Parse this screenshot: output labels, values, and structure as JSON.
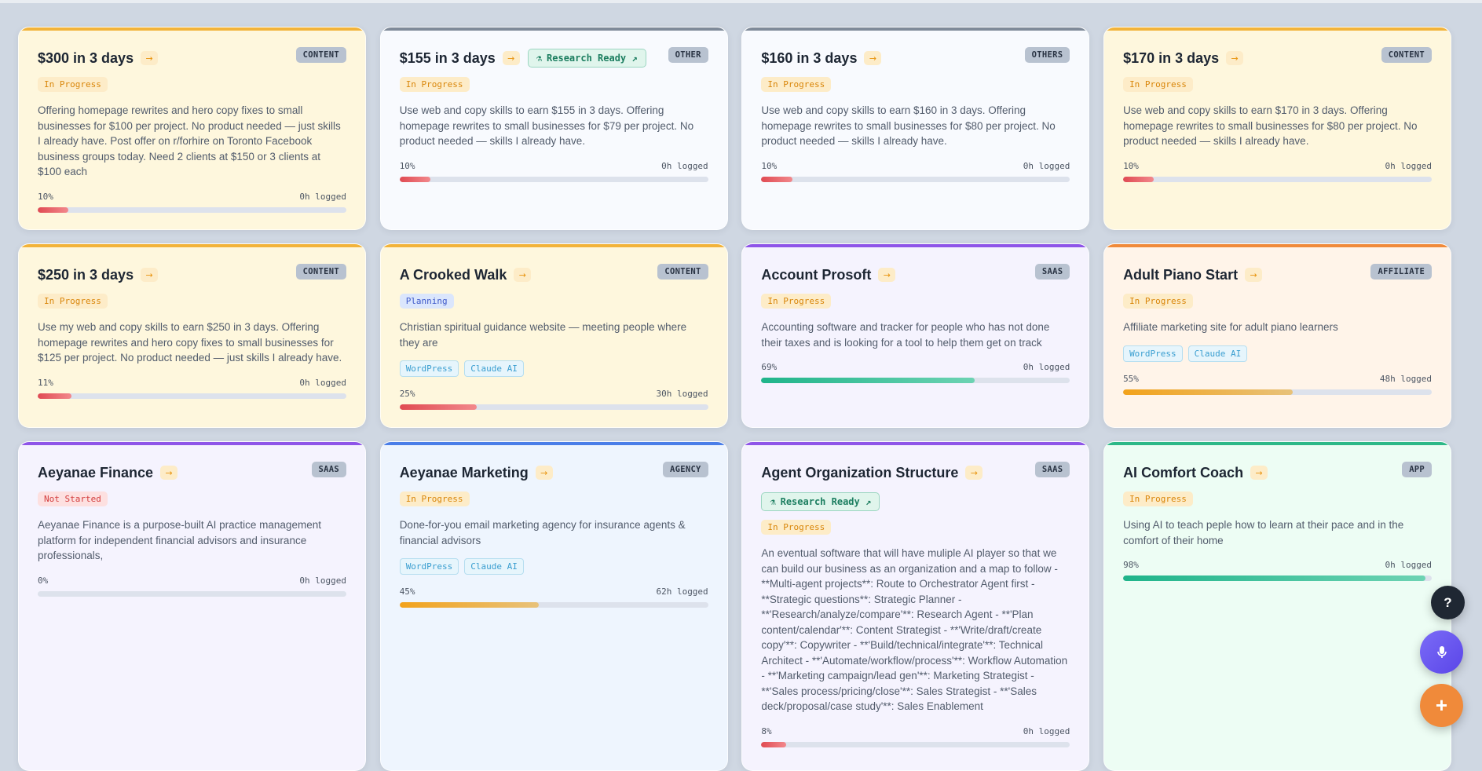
{
  "accents": {
    "yellow": "#f2b33a",
    "slate": "#7f8a99",
    "purple": "#8e55e8",
    "orange": "#f08a3a",
    "blue": "#4a7ee8",
    "green": "#2db888"
  },
  "cards": [
    {
      "title": "$300 in 3 days",
      "arrow": "→",
      "type": "CONTENT",
      "status": "In Progress",
      "research": "",
      "desc": "Offering homepage rewrites and hero copy fixes to small businesses for $100 per project. No product needed — just skills I already have. Post offer on r/forhire on Toronto Facebook business groups today. Need 2 clients at $150 or 3 clients at $100 each",
      "tags": [],
      "percent_label": "10%",
      "progress": 10,
      "logged": "0h logged"
    },
    {
      "title": "$155 in 3 days",
      "arrow": "→",
      "type": "OTHER",
      "status": "In Progress",
      "research": "Research Ready ↗",
      "desc": "Use web and copy skills to earn $155 in 3 days. Offering homepage rewrites to small businesses for $79 per project. No product needed — skills I already have.",
      "tags": [],
      "percent_label": "10%",
      "progress": 10,
      "logged": "0h logged"
    },
    {
      "title": "$160 in 3 days",
      "arrow": "→",
      "type": "OTHERS",
      "status": "In Progress",
      "research": "",
      "desc": "Use web and copy skills to earn $160 in 3 days. Offering homepage rewrites to small businesses for $80 per project. No product needed — skills I already have.",
      "tags": [],
      "percent_label": "10%",
      "progress": 10,
      "logged": "0h logged"
    },
    {
      "title": "$170 in 3 days",
      "arrow": "→",
      "type": "CONTENT",
      "status": "In Progress",
      "research": "",
      "desc": "Use web and copy skills to earn $170 in 3 days. Offering homepage rewrites to small businesses for $80 per project. No product needed — skills I already have.",
      "tags": [],
      "percent_label": "10%",
      "progress": 10,
      "logged": "0h logged"
    },
    {
      "title": "$250 in 3 days",
      "arrow": "→",
      "type": "CONTENT",
      "status": "In Progress",
      "research": "",
      "desc": "Use my web and copy skills to earn $250 in 3 days. Offering homepage rewrites and hero copy fixes to small businesses for $125 per project. No product needed — just skills I already have.",
      "tags": [],
      "percent_label": "11%",
      "progress": 11,
      "logged": "0h logged"
    },
    {
      "title": "A Crooked Walk",
      "arrow": "→",
      "type": "CONTENT",
      "status": "Planning",
      "research": "",
      "desc": "Christian spiritual guidance website — meeting people where they are",
      "tags": [
        "WordPress",
        "Claude AI"
      ],
      "percent_label": "25%",
      "progress": 25,
      "logged": "30h logged"
    },
    {
      "title": "Account Prosoft",
      "arrow": "→",
      "type": "SAAS",
      "status": "In Progress",
      "research": "",
      "desc": "Accounting software and tracker for people who has not done their taxes and is looking for a tool to help them get on track",
      "tags": [],
      "percent_label": "69%",
      "progress": 69,
      "logged": "0h logged"
    },
    {
      "title": "Adult Piano Start",
      "arrow": "→",
      "type": "AFFILIATE",
      "status": "In Progress",
      "research": "",
      "desc": "Affiliate marketing site for adult piano learners",
      "tags": [
        "WordPress",
        "Claude AI"
      ],
      "percent_label": "55%",
      "progress": 55,
      "logged": "48h logged"
    },
    {
      "title": "Aeyanae Finance",
      "arrow": "→",
      "type": "SAAS",
      "status": "Not Started",
      "research": "",
      "desc": "Aeyanae Finance is a purpose-built AI practice management platform for independent financial advisors and insurance professionals,",
      "tags": [],
      "percent_label": "0%",
      "progress": 0,
      "logged": "0h logged"
    },
    {
      "title": "Aeyanae Marketing",
      "arrow": "→",
      "type": "AGENCY",
      "status": "In Progress",
      "research": "",
      "desc": "Done-for-you email marketing agency for insurance agents & financial advisors",
      "tags": [
        "WordPress",
        "Claude AI"
      ],
      "percent_label": "45%",
      "progress": 45,
      "logged": "62h logged"
    },
    {
      "title": "Agent Organization Structure",
      "arrow": "→",
      "type": "SAAS",
      "status": "In Progress",
      "research": "Research Ready ↗",
      "desc": "An eventual software that will have muliple AI player so that we can build our business as an organization and a map to follow - **Multi-agent projects**: Route to Orchestrator Agent first - **Strategic questions**: Strategic Planner - **'Research/analyze/compare'**: Research Agent - **'Plan content/calendar'**: Content Strategist - **'Write/draft/create copy'**: Copywriter - **'Build/technical/integrate'**: Technical Architect - **'Automate/workflow/process'**: Workflow Automation - **'Marketing campaign/lead gen'**: Marketing Strategist - **'Sales process/pricing/close'**: Sales Strategist - **'Sales deck/proposal/case study'**: Sales Enablement",
      "tags": [],
      "percent_label": "8%",
      "progress": 8,
      "logged": "0h logged"
    },
    {
      "title": "AI Comfort Coach",
      "arrow": "→",
      "type": "APP",
      "status": "In Progress",
      "research": "",
      "desc": "Using AI to teach peple how to learn at their pace and in the comfort of their home",
      "tags": [],
      "percent_label": "98%",
      "progress": 98,
      "logged": "0h logged"
    }
  ],
  "fabs": {
    "help": "?",
    "add": "+"
  }
}
